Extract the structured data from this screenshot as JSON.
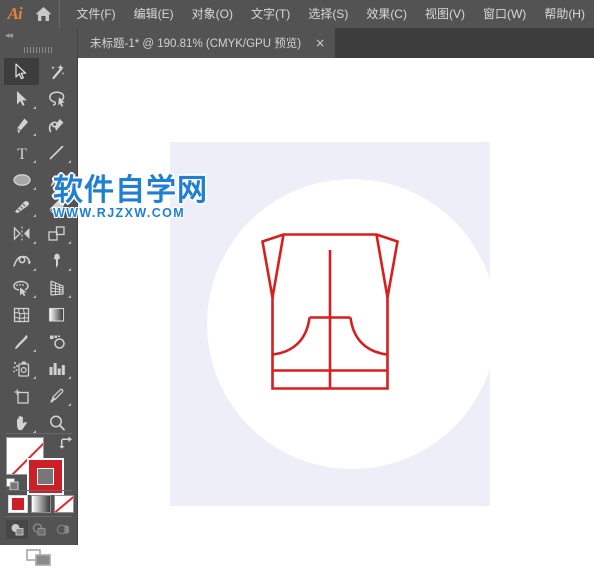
{
  "app": {
    "name": "Adobe Illustrator",
    "logo_text": "Ai",
    "home_icon": "home-icon"
  },
  "menubar": {
    "items": [
      {
        "label": "文件(F)",
        "name": "menu-file"
      },
      {
        "label": "编辑(E)",
        "name": "menu-edit"
      },
      {
        "label": "对象(O)",
        "name": "menu-object"
      },
      {
        "label": "文字(T)",
        "name": "menu-type"
      },
      {
        "label": "选择(S)",
        "name": "menu-select"
      },
      {
        "label": "效果(C)",
        "name": "menu-effect"
      },
      {
        "label": "视图(V)",
        "name": "menu-view"
      },
      {
        "label": "窗口(W)",
        "name": "menu-window"
      },
      {
        "label": "帮助(H)",
        "name": "menu-help"
      }
    ]
  },
  "tabbar": {
    "document_title": "未标题-1* @ 190.81% (CMYK/GPU 预览)",
    "close_label": "×",
    "document_name": "未标题-1",
    "modified": "*",
    "zoom_level": "190.81%",
    "color_mode": "CMYK",
    "gpu_mode": "GPU 预览"
  },
  "toolpanel": {
    "collapse_label": "◂◂",
    "tools": [
      {
        "name": "selection-tool",
        "label": "选择工具",
        "active": true,
        "corner": false
      },
      {
        "name": "magic-wand-tool",
        "label": "魔棒工具",
        "active": false,
        "corner": false
      },
      {
        "name": "direct-selection-tool",
        "label": "直接选择工具",
        "active": false,
        "corner": true
      },
      {
        "name": "lasso-tool",
        "label": "套索工具",
        "active": false,
        "corner": false
      },
      {
        "name": "pen-tool",
        "label": "钢笔工具",
        "active": false,
        "corner": true
      },
      {
        "name": "curvature-tool",
        "label": "曲率工具",
        "active": false,
        "corner": false
      },
      {
        "name": "type-tool",
        "label": "文字工具",
        "active": false,
        "corner": true
      },
      {
        "name": "line-segment-tool",
        "label": "直线段工具",
        "active": false,
        "corner": true
      },
      {
        "name": "ellipse-tool",
        "label": "椭圆工具",
        "active": false,
        "corner": true
      },
      {
        "name": "paintbrush-tool",
        "label": "画笔工具",
        "active": false,
        "corner": true
      },
      {
        "name": "blob-brush-tool",
        "label": "斑点画笔工具",
        "active": false,
        "corner": true
      },
      {
        "name": "eraser-tool",
        "label": "橡皮擦工具",
        "active": false,
        "corner": true
      },
      {
        "name": "rotate-reflect-tool",
        "label": "旋转工具",
        "active": false,
        "corner": true
      },
      {
        "name": "scale-tool",
        "label": "缩放工具",
        "active": false,
        "corner": true
      },
      {
        "name": "width-warp-tool",
        "label": "宽度工具",
        "active": false,
        "corner": true
      },
      {
        "name": "free-transform-tool",
        "label": "自由变换工具",
        "active": false,
        "corner": true
      },
      {
        "name": "shape-builder-tool",
        "label": "形状生成器工具",
        "active": false,
        "corner": true
      },
      {
        "name": "perspective-grid-tool",
        "label": "透视网格工具",
        "active": false,
        "corner": true
      },
      {
        "name": "mesh-tool",
        "label": "网格工具",
        "active": false,
        "corner": false
      },
      {
        "name": "gradient-tool",
        "label": "渐变工具",
        "active": false,
        "corner": false
      },
      {
        "name": "eyedropper-tool",
        "label": "吸管工具",
        "active": false,
        "corner": true
      },
      {
        "name": "blend-tool",
        "label": "混合工具",
        "active": false,
        "corner": false
      },
      {
        "name": "symbol-sprayer-tool",
        "label": "符号喷枪工具",
        "active": false,
        "corner": true
      },
      {
        "name": "column-graph-tool",
        "label": "柱形图工具",
        "active": false,
        "corner": true
      },
      {
        "name": "artboard-tool",
        "label": "画板工具",
        "active": false,
        "corner": false
      },
      {
        "name": "slice-tool",
        "label": "切片工具",
        "active": false,
        "corner": true
      },
      {
        "name": "hand-tool",
        "label": "抄手工具",
        "active": false,
        "corner": true
      },
      {
        "name": "zoom-tool",
        "label": "缩放工具",
        "active": false,
        "corner": false
      }
    ],
    "colors": {
      "fill": "#ffffff",
      "fill_is_none": true,
      "stroke": "#cc2026",
      "none_slash": "#e8262a"
    },
    "fill_stroke": {
      "fill_name": "fill-swatch",
      "stroke_name": "stroke-swatch",
      "swap_name": "swap-fill-stroke-icon",
      "default_name": "default-fill-stroke-icon"
    },
    "paint_modes": [
      {
        "name": "color-mode-button",
        "selected": true
      },
      {
        "name": "gradient-mode-button",
        "selected": false
      },
      {
        "name": "none-mode-button",
        "selected": false
      }
    ],
    "draw_modes": [
      {
        "name": "draw-normal-button",
        "selected": true
      },
      {
        "name": "draw-behind-button",
        "selected": false
      },
      {
        "name": "draw-inside-button",
        "selected": false
      }
    ],
    "screen_mode": {
      "name": "change-screen-mode-button"
    }
  },
  "canvas": {
    "background": "#ffffff",
    "artboard_background": "#edeef8",
    "circle_color": "#ffffff",
    "artwork": {
      "name": "vest-shirt-outline",
      "stroke_color": "#d81e1e",
      "stroke_width": 2.6,
      "fill": "none"
    }
  },
  "watermark": {
    "main_text": "软件自学网",
    "sub_text": "WWW.RJZXW.COM",
    "color": "#1f7fd4"
  }
}
